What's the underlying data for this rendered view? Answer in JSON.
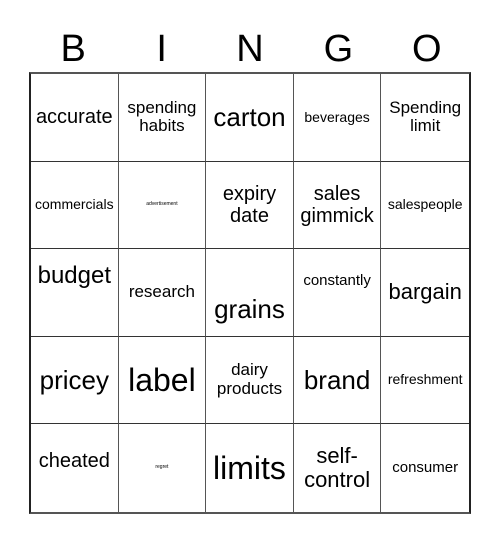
{
  "header": {
    "letters": [
      "B",
      "I",
      "N",
      "G",
      "O"
    ]
  },
  "board": {
    "rows": [
      [
        "accurate",
        "spending habits",
        "carton",
        "beverages",
        "Spending limit"
      ],
      [
        "commercials",
        "advertisement",
        "expiry date",
        "sales gimmick",
        "salespeople"
      ],
      [
        "budget",
        "research",
        "grains",
        "constantly",
        "bargain"
      ],
      [
        "pricey",
        "label",
        "dairy products",
        "brand",
        "refreshment"
      ],
      [
        "cheated",
        "regret",
        "limits",
        "self-control",
        "consumer"
      ]
    ]
  }
}
